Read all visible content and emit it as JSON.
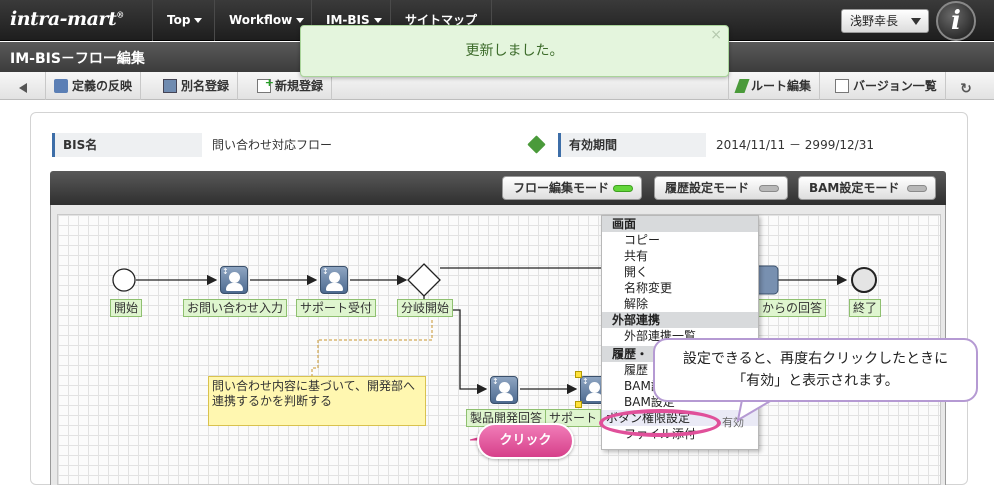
{
  "app": {
    "logo_text": "intra-mart",
    "logo_mark": "®",
    "nav": [
      {
        "label": "Top"
      },
      {
        "label": "Workflow"
      },
      {
        "label": "IM-BIS"
      },
      {
        "label": "サイトマップ"
      }
    ],
    "user_name": "浅野幸長",
    "avatar_letter": "i"
  },
  "page": {
    "title": "IM-BIS－フロー編集"
  },
  "toolbar": {
    "reflect_label": "定義の反映",
    "alias_label": "別名登録",
    "new_label": "新規登録",
    "route_edit_label": "ルート編集",
    "version_list_label": "バージョン一覧",
    "refresh_icon": "↻"
  },
  "notification": {
    "message": "更新しました。",
    "close": "×"
  },
  "info": {
    "bis_name_label": "BIS名",
    "bis_name_value": "問い合わせ対応フロー",
    "period_label": "有効期間",
    "period_value": "2014/11/11 － 2999/12/31"
  },
  "modes": [
    {
      "label": "フロー編集モード",
      "active": true
    },
    {
      "label": "履歴設定モード",
      "active": false
    },
    {
      "label": "BAM設定モード",
      "active": false
    }
  ],
  "flow": {
    "nodes": [
      {
        "label": "開始"
      },
      {
        "label": "お問い合わせ入力"
      },
      {
        "label": "サポート受付"
      },
      {
        "label": "分岐開始"
      },
      {
        "label": "からの回答"
      },
      {
        "label": "終了"
      },
      {
        "label": "製品開発回答"
      },
      {
        "label": "サポート"
      }
    ],
    "note_text": "問い合わせ内容に基づいて、開発部へ連携するかを判断する"
  },
  "context_menu": {
    "sections": [
      {
        "title": "画面",
        "items": [
          "コピー",
          "共有",
          "開く",
          "名称変更",
          "解除"
        ]
      },
      {
        "title": "外部連携",
        "items": [
          "外部連携一覧"
        ]
      },
      {
        "title": "履歴・",
        "items": [
          "履歴",
          "BAM設",
          "BAM設定",
          "ボタン権限設定",
          "ファイル添付"
        ]
      }
    ]
  },
  "callout": {
    "line1": "設定できると、再度右クリックしたときに",
    "line2": "「有効」と表示されます。"
  },
  "click_badge": "クリック",
  "status_yuko": "有効"
}
